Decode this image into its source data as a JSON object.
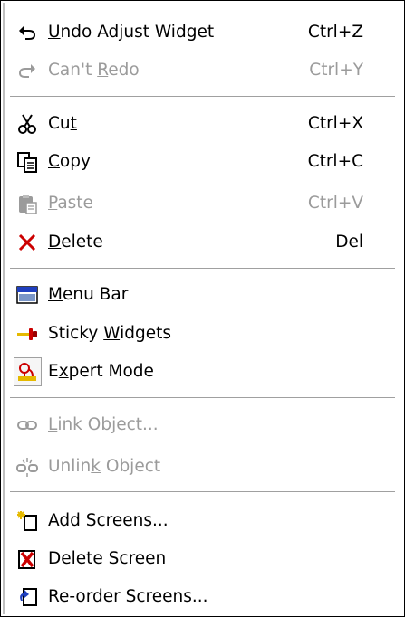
{
  "menu": {
    "items": [
      {
        "pre": "",
        "ul": "U",
        "post": "ndo Adjust Widget",
        "shortcut": "Ctrl+Z",
        "icon": "undo-icon",
        "enabled": true
      },
      {
        "pre": "Can't ",
        "ul": "R",
        "post": "edo",
        "shortcut": "Ctrl+Y",
        "icon": "redo-icon",
        "enabled": false
      },
      {
        "pre": "Cu",
        "ul": "t",
        "post": "",
        "shortcut": "Ctrl+X",
        "icon": "scissors-icon",
        "enabled": true
      },
      {
        "pre": "",
        "ul": "C",
        "post": "opy",
        "shortcut": "Ctrl+C",
        "icon": "copy-icon",
        "enabled": true
      },
      {
        "pre": "",
        "ul": "P",
        "post": "aste",
        "shortcut": "Ctrl+V",
        "icon": "paste-icon",
        "enabled": false
      },
      {
        "pre": "",
        "ul": "D",
        "post": "elete",
        "shortcut": "Del",
        "icon": "delete-x-icon",
        "enabled": true
      },
      {
        "pre": "",
        "ul": "M",
        "post": "enu Bar",
        "shortcut": "",
        "icon": "menu-bar-icon",
        "enabled": true
      },
      {
        "pre": "Sticky ",
        "ul": "W",
        "post": "idgets",
        "shortcut": "",
        "icon": "pin-icon",
        "enabled": true
      },
      {
        "pre": "E",
        "ul": "x",
        "post": "pert Mode",
        "shortcut": "",
        "icon": "expert-mode-icon",
        "enabled": true,
        "checked": true
      },
      {
        "pre": "",
        "ul": "L",
        "post": "ink Object...",
        "shortcut": "",
        "icon": "link-icon",
        "enabled": false
      },
      {
        "pre": "Unlin",
        "ul": "k",
        "post": " Object",
        "shortcut": "",
        "icon": "unlink-icon",
        "enabled": false
      },
      {
        "pre": "",
        "ul": "A",
        "post": "dd Screens...",
        "shortcut": "",
        "icon": "add-screen-icon",
        "enabled": true
      },
      {
        "pre": "",
        "ul": "D",
        "post": "elete Screen",
        "shortcut": "",
        "icon": "delete-screen-icon",
        "enabled": true
      },
      {
        "pre": "",
        "ul": "R",
        "post": "e-order Screens...",
        "shortcut": "",
        "icon": "reorder-screens-icon",
        "enabled": true
      }
    ]
  },
  "colors": {
    "text": "#000000",
    "disabled_text": "#9b9b9b",
    "separator": "#a0a0a0",
    "delete_red": "#cc0000",
    "icon_blue": "#1f3fbf"
  }
}
